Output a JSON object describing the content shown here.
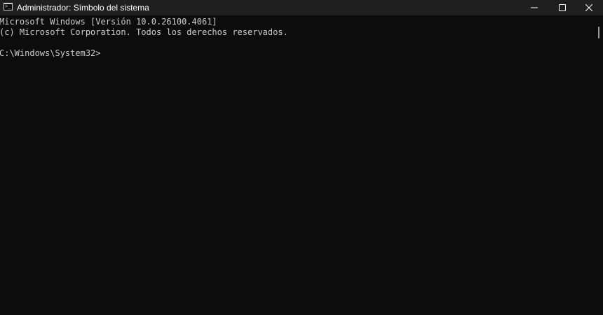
{
  "window": {
    "title": "Administrador: Símbolo del sistema",
    "app_icon": "command-prompt-icon",
    "buttons": {
      "minimize_icon": "minimize-icon",
      "maximize_icon": "maximize-icon",
      "close_icon": "close-icon"
    }
  },
  "terminal": {
    "line1": "Microsoft Windows [Versión 10.0.26100.4061]",
    "line2": "(c) Microsoft Corporation. Todos los derechos reservados.",
    "prompt": "C:\\Windows\\System32>"
  },
  "colors": {
    "background": "#0c0c0c",
    "titlebar": "#1f1f1f",
    "text": "#cccccc"
  }
}
